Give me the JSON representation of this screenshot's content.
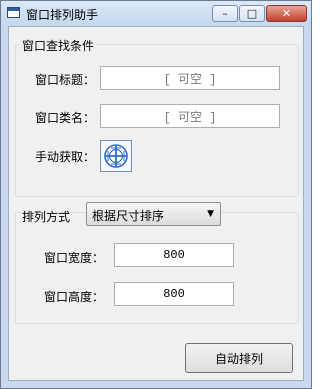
{
  "window": {
    "title": "窗口排列助手",
    "controls": {
      "minimize": "–",
      "maximize": "□",
      "close": "✕"
    }
  },
  "find_group": {
    "title": "窗口查找条件",
    "title_label": "窗口标题：",
    "title_placeholder": "[ 可空 ]",
    "class_label": "窗口类名：",
    "class_placeholder": "[ 可空 ]",
    "manual_label": "手动获取：",
    "picker_icon": "crosshair-target-icon"
  },
  "arrange_group": {
    "mode_label": "排列方式",
    "mode_selected": "根据尺寸排序",
    "width_label": "窗口宽度：",
    "width_value": "800",
    "height_label": "窗口高度：",
    "height_value": "800"
  },
  "actions": {
    "auto_arrange": "自动排列"
  },
  "colors": {
    "title_bar": "#c9daf0",
    "accent": "#2f6fc0",
    "close": "#c2412a"
  }
}
